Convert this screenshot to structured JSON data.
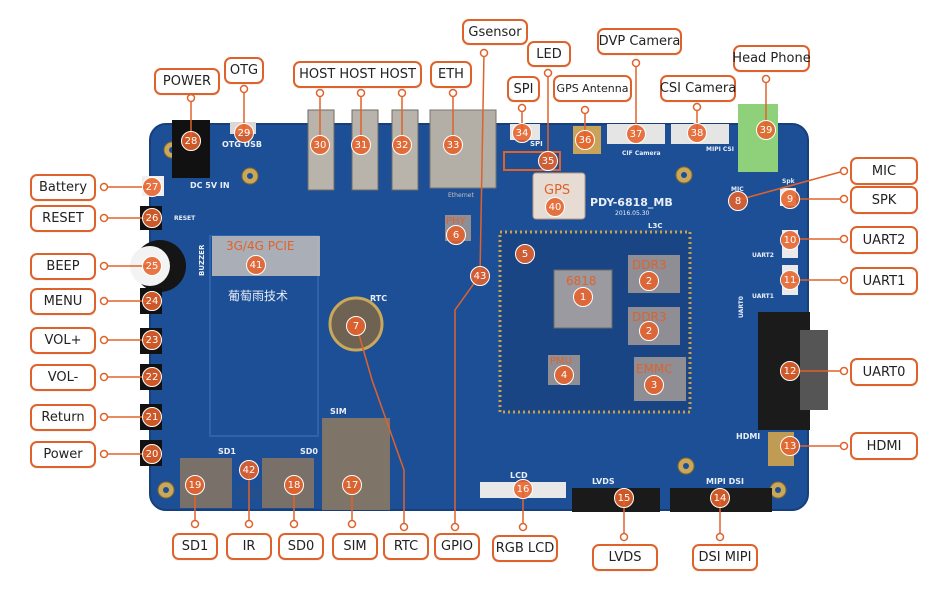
{
  "board": {
    "model": "PDY-6818_MB",
    "date": "2016.05.30",
    "brand_text": "葡萄雨技术",
    "revision": "L3C",
    "colors": {
      "pcb": "#1d4f96",
      "pcb_dark": "#163f7c",
      "accent": "#e0622b"
    }
  },
  "silkscreen": {
    "otg_usb": "OTG USB",
    "dc_in": "DC 5V IN",
    "rtc": "RTC",
    "sd1": "SD1",
    "sd0": "SD0",
    "sim": "SIM",
    "lcd": "LCD",
    "lvds": "LVDS",
    "mipi_dsi": "MIPI DSI",
    "hdmi": "HDMI",
    "uart0": "UART0",
    "uart1": "UART1",
    "uart2": "UART2",
    "cif_camera": "CIF Camera",
    "mipi_csi": "MIPI CSI",
    "spi": "SPI",
    "buzzer": "BUZZER",
    "reset": "RESET",
    "mic": "MIC",
    "spk": "Spk",
    "ethernet": "Ethernet"
  },
  "chips": [
    {
      "id": "1",
      "label": "6818"
    },
    {
      "id": "2a",
      "label": "DDR3"
    },
    {
      "id": "2b",
      "label": "DDR3"
    },
    {
      "id": "3",
      "label": "EMMC"
    },
    {
      "id": "4",
      "label": "PMU"
    },
    {
      "id": "6",
      "label": "PHY"
    },
    {
      "id": "40",
      "label": "GPS"
    },
    {
      "id": "41",
      "label": "3G/4G PCIE"
    }
  ],
  "markers": [
    "1",
    "2",
    "2",
    "3",
    "4",
    "5",
    "6",
    "7",
    "8",
    "9",
    "10",
    "11",
    "12",
    "13",
    "14",
    "15",
    "16",
    "17",
    "18",
    "19",
    "20",
    "21",
    "22",
    "23",
    "24",
    "25",
    "26",
    "27",
    "28",
    "29",
    "30",
    "31",
    "32",
    "33",
    "34",
    "35",
    "36",
    "37",
    "38",
    "39",
    "40",
    "41",
    "42",
    "43"
  ],
  "callouts": {
    "power_top": "POWER",
    "otg": "OTG",
    "host": "HOST  HOST  HOST",
    "eth": "ETH",
    "gsensor": "Gsensor",
    "spi": "SPI",
    "led": "LED",
    "gps_antenna": "GPS Antenna",
    "dvp_camera": "DVP Camera",
    "csi_camera": "CSI Camera",
    "head_phone": "Head Phone",
    "mic": "MIC",
    "spk": "SPK",
    "uart2": "UART2",
    "uart1": "UART1",
    "uart0": "UART0",
    "hdmi": "HDMI",
    "battery": "Battery",
    "reset": "RESET",
    "beep": "BEEP",
    "menu": "MENU",
    "vol_plus": "VOL+",
    "vol_minus": "VOL-",
    "return": "Return",
    "power_key": "Power",
    "sd1": "SD1",
    "ir": "IR",
    "sd0": "SD0",
    "sim": "SIM",
    "rtc": "RTC",
    "gpio": "GPIO",
    "rgb_lcd": "RGB LCD",
    "lvds": "LVDS",
    "dsi_mipi": "DSI MIPI"
  }
}
